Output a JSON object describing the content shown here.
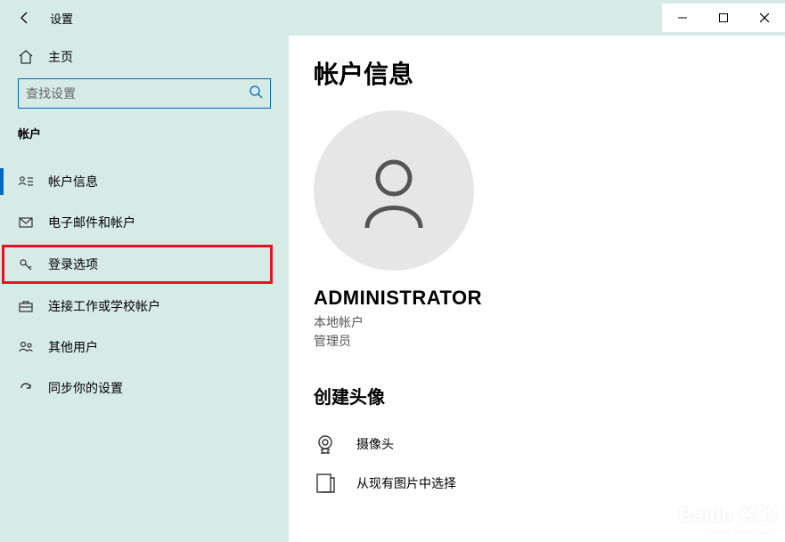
{
  "window": {
    "title": "设置"
  },
  "sidebar": {
    "home_label": "主页",
    "search_placeholder": "查找设置",
    "section_label": "帐户",
    "items": [
      {
        "label": "帐户信息"
      },
      {
        "label": "电子邮件和帐户"
      },
      {
        "label": "登录选项"
      },
      {
        "label": "连接工作或学校帐户"
      },
      {
        "label": "其他用户"
      },
      {
        "label": "同步你的设置"
      }
    ]
  },
  "main": {
    "page_title": "帐户信息",
    "username": "ADMINISTRATOR",
    "account_type": "本地帐户",
    "role": "管理员",
    "create_avatar_heading": "创建头像",
    "options": [
      {
        "label": "摄像头"
      },
      {
        "label": "从现有图片中选择"
      }
    ]
  },
  "watermark": {
    "brand": "Baidu 经验",
    "sub": "jingyan.baidu.com"
  }
}
